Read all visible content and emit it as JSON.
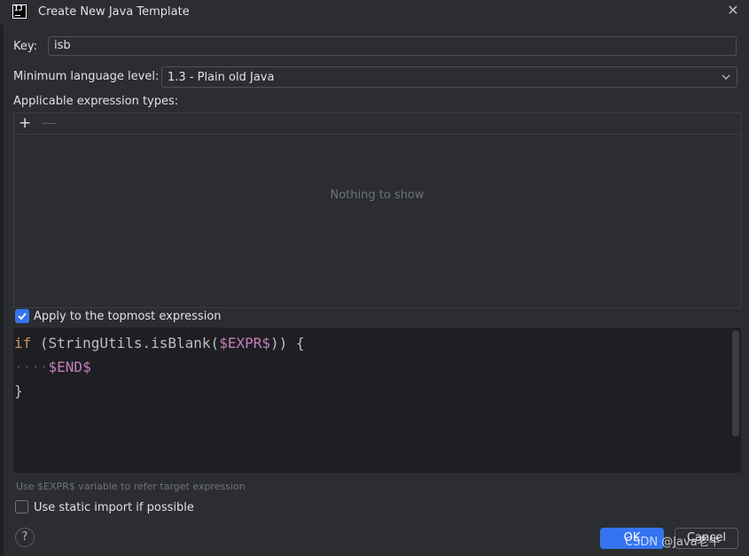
{
  "dialog": {
    "title": "Create New Java Template",
    "app_icon": "IJ"
  },
  "key": {
    "label": "Key:",
    "value": "isb"
  },
  "language_level": {
    "label": "Minimum language level:",
    "value": "1.3 - Plain old Java"
  },
  "expression_types": {
    "label": "Applicable expression types:",
    "empty_text": "Nothing to show"
  },
  "apply_topmost": {
    "label": "Apply to the topmost expression",
    "checked": true
  },
  "editor": {
    "line1_kw": "if",
    "line1_rest": " (StringUtils.isBlank(",
    "line1_var": "$EXPR$",
    "line1_end": ")) {",
    "line2_dots": "····",
    "line2_var": "$END$",
    "line3": "}"
  },
  "hint": "Use $EXPR$ variable to refer target expression",
  "static_import": {
    "label": "Use static import if possible",
    "checked": false
  },
  "buttons": {
    "ok": "OK",
    "cancel": "Cancel",
    "help": "?"
  },
  "watermark": "CSDN @Java老牛",
  "colors": {
    "accent": "#3574f0",
    "background": "#2b2d30",
    "editor_bg": "#1e1f22",
    "keyword": "#cf8e6d"
  }
}
